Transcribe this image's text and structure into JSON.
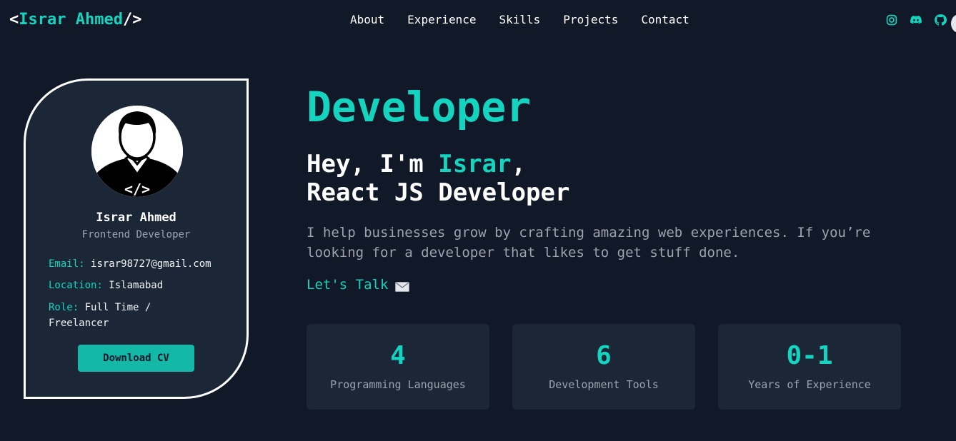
{
  "nav": {
    "logo": {
      "open": "<",
      "name": "Israr Ahmed",
      "close": "/>"
    },
    "links": [
      "About",
      "Experience",
      "Skills",
      "Projects",
      "Contact"
    ],
    "socials": [
      "instagram-icon",
      "discord-icon",
      "github-icon"
    ]
  },
  "profile": {
    "name": "Israr Ahmed",
    "role": "Frontend Developer",
    "email_label": "Email:",
    "email": "israr98727@gmail.com",
    "location_label": "Location:",
    "location": "Islamabad",
    "role_label": "Role:",
    "role_value": "Full Time / Freelancer",
    "download_label": "Download CV"
  },
  "hero": {
    "title": "Developer",
    "greeting_prefix": "Hey, I'm ",
    "greeting_name": "Israr",
    "greeting_suffix": ",",
    "headline": "React JS Developer",
    "description": "I help businesses grow by crafting amazing web experiences. If you’re looking for a developer that likes to get stuff done.",
    "cta": "Let's Talk"
  },
  "stats": [
    {
      "value": "4",
      "label": "Programming Languages"
    },
    {
      "value": "6",
      "label": "Development Tools"
    },
    {
      "value": "0-1",
      "label": "Years of Experience"
    }
  ],
  "colors": {
    "accent": "#14d3bf",
    "background": "#111827",
    "card": "#1b2737",
    "button": "#14b8a6"
  }
}
